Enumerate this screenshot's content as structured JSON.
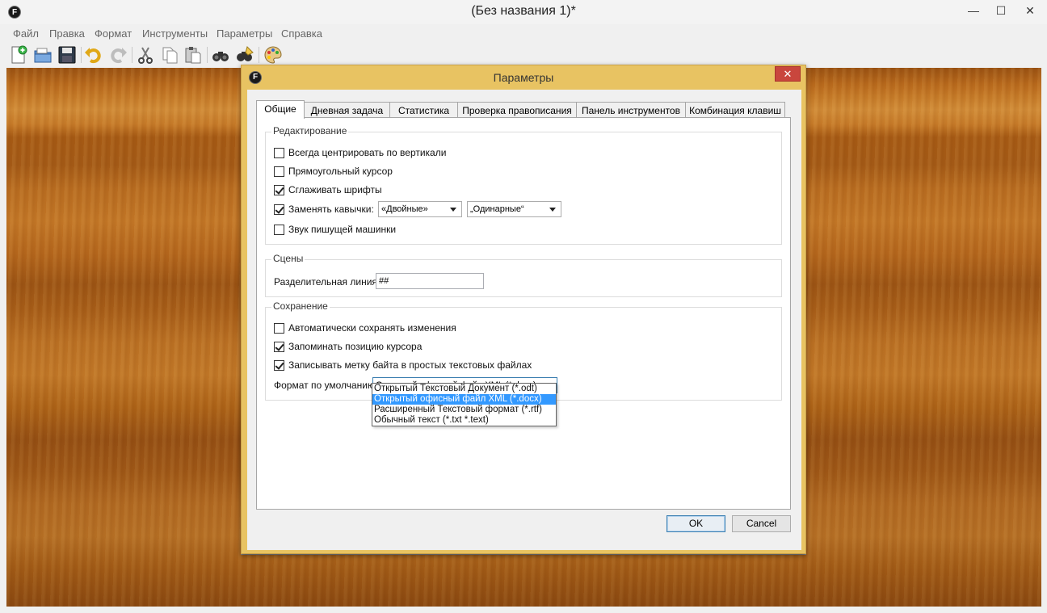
{
  "window": {
    "title": "(Без названия 1)*",
    "minimize": "—",
    "maximize": "☐",
    "close": "✕"
  },
  "menu": [
    "Файл",
    "Правка",
    "Формат",
    "Инструменты",
    "Параметры",
    "Справка"
  ],
  "toolbar_icons": [
    "new-document-icon",
    "open-folder-icon",
    "save-icon",
    "undo-icon",
    "redo-icon",
    "cut-icon",
    "copy-icon",
    "paste-icon",
    "find-icon",
    "find-replace-icon",
    "themes-icon"
  ],
  "dialog": {
    "title": "Параметры",
    "close": "✕",
    "tabs": [
      "Общие",
      "Дневная задача",
      "Статистика",
      "Проверка правописания",
      "Панель инструментов",
      "Комбинация клавиш"
    ],
    "active_tab": "Общие",
    "editing": {
      "title": "Редактирование",
      "always_center": {
        "label": "Всегда центрировать по вертикали",
        "checked": false
      },
      "block_cursor": {
        "label": "Прямоугольный курсор",
        "checked": false
      },
      "smooth_fonts": {
        "label": "Сглаживать шрифты",
        "checked": true
      },
      "smart_quotes": {
        "label": "Заменять кавычки:",
        "checked": true
      },
      "double_quotes": "«Двойные»",
      "single_quotes": "„Одинарные“",
      "typewriter_sound": {
        "label": "Звук пишущей машинки",
        "checked": false
      }
    },
    "scenes": {
      "title": "Сцены",
      "divider_label": "Разделительная линия:",
      "divider_value": "##"
    },
    "saving": {
      "title": "Сохранение",
      "autosave": {
        "label": "Автоматически сохранять изменения",
        "checked": false
      },
      "remember_cursor": {
        "label": "Запоминать позицию курсора",
        "checked": true
      },
      "write_bom": {
        "label": "Записывать метку байта в простых текстовых файлах",
        "checked": true
      },
      "default_format_label": "Формат по умолчанию:",
      "default_format_value": "Открытый офисный файл XML (*.docx)",
      "format_options": [
        "Открытый Текстовый Документ (*.odt)",
        "Открытый офисный файл XML (*.docx)",
        "Расширенный Текстовый формат (*.rtf)",
        "Обычный текст (*.txt *.text)"
      ],
      "selected_option_index": 1
    },
    "ok": "OK",
    "cancel": "Cancel"
  }
}
